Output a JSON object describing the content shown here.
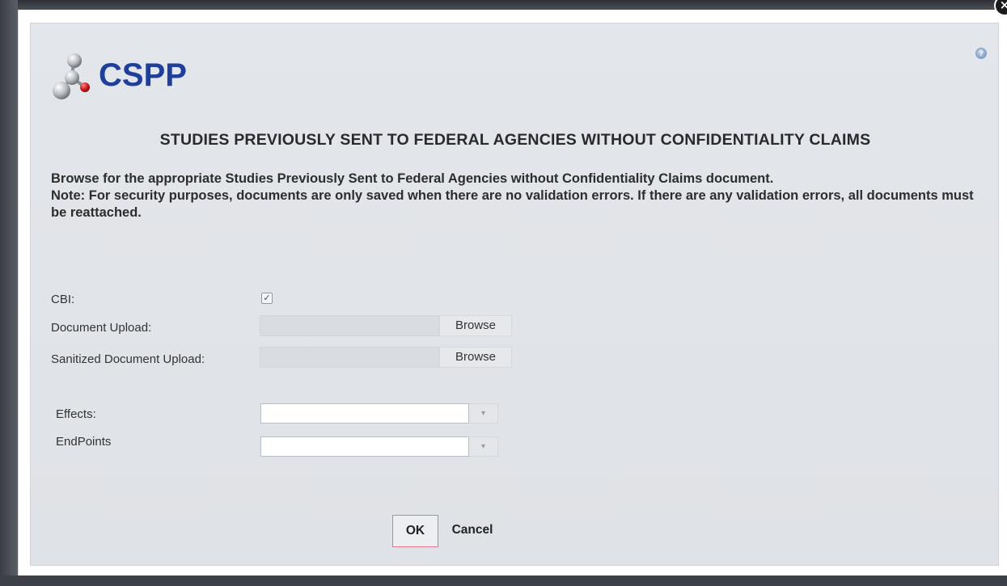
{
  "app": {
    "logo_text": "CSPP"
  },
  "dialog": {
    "title": "STUDIES PREVIOUSLY SENT TO FEDERAL AGENCIES WITHOUT CONFIDENTIALITY CLAIMS",
    "instruction_line1": "Browse for the appropriate Studies Previously Sent to Federal Agencies without Confidentiality Claims document.",
    "instruction_line2": "Note: For security purposes, documents are only saved when there are no validation errors. If there are any validation errors, all documents must be reattached.",
    "help_icon": "help-icon",
    "close_icon": "close-icon",
    "close_glyph": "×",
    "help_glyph": "?"
  },
  "form": {
    "cbi_label": "CBI:",
    "cbi_checked": true,
    "cbi_check_glyph": "✓",
    "document_upload_label": "Document Upload:",
    "document_upload_value": "",
    "document_browse_label": "Browse",
    "sanitized_upload_label": "Sanitized Document Upload:",
    "sanitized_upload_value": "",
    "sanitized_browse_label": "Browse",
    "effects_label": "Effects:",
    "effects_value": "",
    "endpoints_label": "EndPoints",
    "endpoints_value": "",
    "dropdown_glyph": "▾"
  },
  "actions": {
    "ok_label": "OK",
    "cancel_label": "Cancel"
  },
  "colors": {
    "logo_blue": "#1f3f9c",
    "ok_focus_border": "#d97b8c",
    "dialog_background": "#e1e4e8"
  }
}
